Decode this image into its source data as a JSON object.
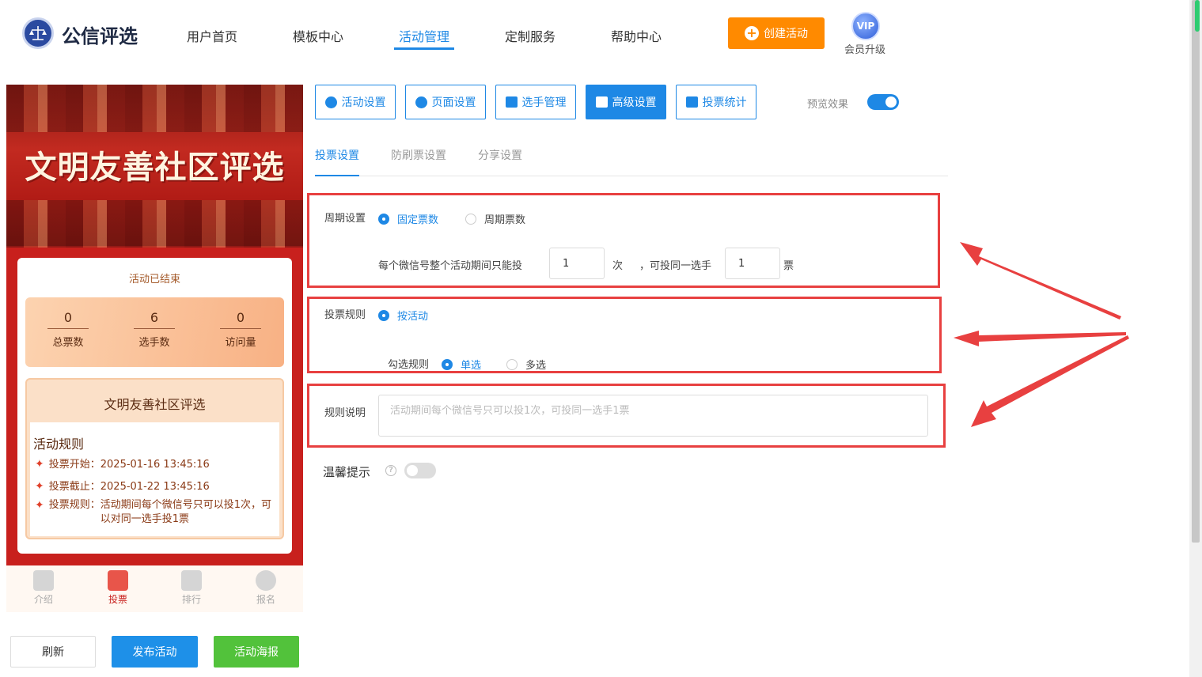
{
  "brand": {
    "name": "公信评选",
    "logo_icon": "scales-icon"
  },
  "nav": [
    {
      "label": "用户首页"
    },
    {
      "label": "模板中心"
    },
    {
      "label": "活动管理",
      "active": true
    },
    {
      "label": "定制服务"
    },
    {
      "label": "帮助中心"
    }
  ],
  "header": {
    "create_label": "创建活动",
    "vip_badge": "VIP",
    "vip_label": "会员升级"
  },
  "colors": {
    "primary": "#1e88e5",
    "accent": "#ff8a00",
    "highlight": "#e84040",
    "poster": "#52c23b"
  },
  "preview": {
    "banner_title": "文明友善社区评选",
    "status": "活动已结束",
    "stats": [
      {
        "value": "0",
        "label": "总票数"
      },
      {
        "value": "6",
        "label": "选手数"
      },
      {
        "value": "0",
        "label": "访问量"
      }
    ],
    "info_title": "文明友善社区评选",
    "rules_heading": "活动规则",
    "rules": [
      {
        "label": "投票开始：",
        "value": "2025-01-16 13:45:16"
      },
      {
        "label": "投票截止：",
        "value": "2025-01-22 13:45:16"
      },
      {
        "label": "投票规则：",
        "value": "活动期间每个微信号只可以投1次，可以对同一选手投1票"
      }
    ],
    "tabs": [
      {
        "label": "介绍",
        "icon": "document-icon"
      },
      {
        "label": "投票",
        "icon": "home-icon",
        "active": true
      },
      {
        "label": "排行",
        "icon": "crown-icon"
      },
      {
        "label": "报名",
        "icon": "person-icon"
      }
    ]
  },
  "actions": {
    "refresh": "刷新",
    "publish": "发布活动",
    "poster": "活动海报"
  },
  "settings_tabs": [
    {
      "label": "活动设置",
      "icon": "star-icon"
    },
    {
      "label": "页面设置",
      "icon": "gear-icon"
    },
    {
      "label": "选手管理",
      "icon": "users-icon"
    },
    {
      "label": "高级设置",
      "icon": "sliders-icon",
      "active": true
    },
    {
      "label": "投票统计",
      "icon": "bar-chart-icon"
    }
  ],
  "preview_toggle": {
    "label": "预览效果",
    "on": true
  },
  "subtabs": [
    {
      "label": "投票设置",
      "active": true
    },
    {
      "label": "防刷票设置"
    },
    {
      "label": "分享设置"
    }
  ],
  "period": {
    "label": "周期设置",
    "options": [
      "固定票数",
      "周期票数"
    ],
    "selected": "固定票数",
    "line_prefix": "每个微信号整个活动期间只能投",
    "times_value": "1",
    "times_unit": "次",
    "same_prefix": "，可投同一选手",
    "votes_value": "1",
    "votes_unit": "票"
  },
  "vote_rule": {
    "label": "投票规则",
    "option": "按活动",
    "select_label": "勾选规则",
    "select_options": [
      "单选",
      "多选"
    ],
    "selected": "单选"
  },
  "rule_desc": {
    "label": "规则说明",
    "placeholder": "活动期间每个微信号只可以投1次，可投同一选手1票"
  },
  "tip": {
    "label": "温馨提示",
    "help": "?",
    "on": false
  }
}
